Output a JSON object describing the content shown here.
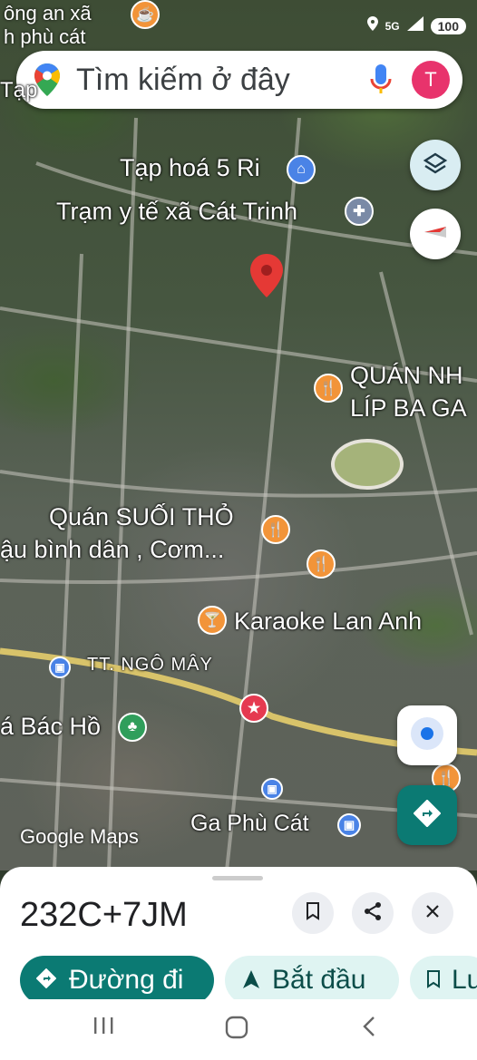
{
  "status_bar": {
    "top_left_text_1": "ông an xã",
    "top_left_text_2": "h phù cát",
    "left_label": "Tạp",
    "network": "5G",
    "battery": "100"
  },
  "search": {
    "placeholder": "Tìm kiếm ở đây",
    "avatar_letter": "T"
  },
  "map_labels": {
    "store": "Tạp hoá 5 Ri",
    "clinic": "Trạm y tế xã Cát Trinh",
    "restaurant_1_line1": "QUÁN NH",
    "restaurant_1_line2": "LÍP BA GA",
    "restaurant_2_line1": "Quán SUỐI THỎ",
    "restaurant_2_line2": "ậu bình dân , Cơm...",
    "karaoke": "Karaoke Lan Anh",
    "town": "TT. NGÔ MÂY",
    "park": "á Bác Hồ",
    "station": "Ga Phù Cát",
    "watermark": "Google Maps"
  },
  "colors": {
    "pin_red": "#e53935",
    "poi_orange": "#f29439",
    "poi_blue": "#4a83e6",
    "poi_green": "#2f9e5b",
    "accent_teal": "#0b7a73",
    "chip_light": "#dff4f2"
  },
  "sheet": {
    "plus_code": "232C+7JM",
    "chips": [
      {
        "label": "Đường đi",
        "icon": "directions-icon"
      },
      {
        "label": "Bắt đầu",
        "icon": "navigation-arrow-icon"
      },
      {
        "label": "Lư",
        "icon": "bookmark-icon"
      }
    ]
  }
}
